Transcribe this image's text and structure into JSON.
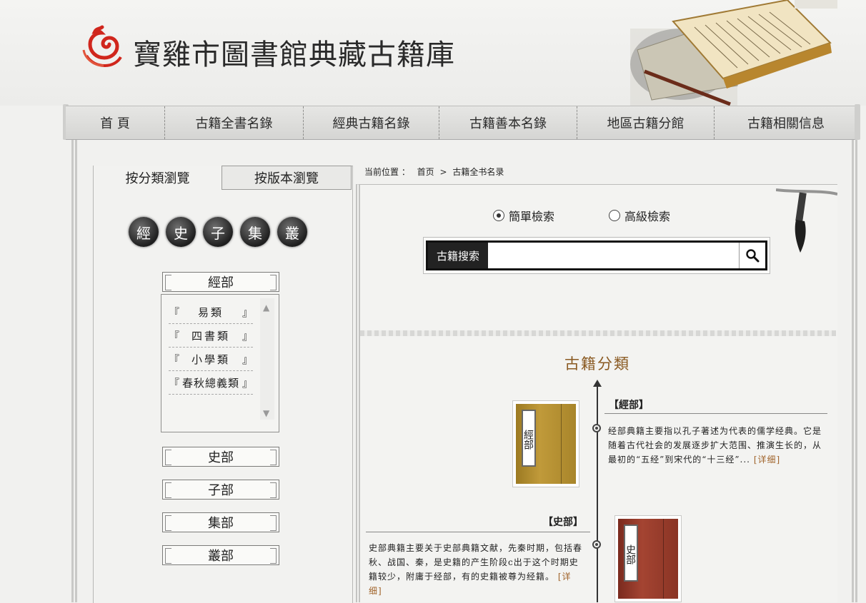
{
  "header": {
    "site_title": "寶雞市圖書館典藏古籍庫"
  },
  "nav": {
    "items": [
      "首 頁",
      "古籍全書名錄",
      "經典古籍名錄",
      "古籍善本名錄",
      "地區古籍分館",
      "古籍相關信息"
    ]
  },
  "left": {
    "tabs": [
      "按分類瀏覽",
      "按版本瀏覽"
    ],
    "quick_circles": [
      "經",
      "史",
      "子",
      "集",
      "叢"
    ],
    "categories": {
      "jing": "經部",
      "shi": "史部",
      "zi": "子部",
      "ji": "集部",
      "cong": "叢部"
    },
    "jing_sub": [
      {
        "open": "『",
        "name": "易類",
        "close": "』"
      },
      {
        "open": "『",
        "name": "四書類",
        "close": "』"
      },
      {
        "open": "『",
        "name": "小學類",
        "close": "』"
      },
      {
        "open": "『",
        "name": "春秋總義類",
        "close": "』"
      }
    ]
  },
  "breadcrumb": {
    "prefix": "当前位置 ：",
    "home": "首页",
    "sep": ">",
    "current": "古籍全书名录"
  },
  "search": {
    "radio_simple": "簡單檢索",
    "radio_advanced": "高級檢索",
    "label": "古籍搜索",
    "value": "",
    "placeholder": ""
  },
  "section_title": "古籍分類",
  "entries": {
    "jing": {
      "head": "【經部】",
      "cover_label": "經部",
      "text": "经部典籍主要指以孔子著述为代表的儒学经典。它是随着古代社会的发展逐步扩大范围、推演生长的，从最初的“五经”到宋代的“十三经”...",
      "more": "[详细]"
    },
    "shi": {
      "head": "【史部】",
      "cover_label": "史部",
      "text": "史部典籍主要关于史部典籍文献，先秦时期，包括春秋、战国、秦，是史籍的产生阶段c出于这个时期史籍较少，附庸于经部，有的史籍被尊为经籍。",
      "more": "[详细]"
    }
  },
  "colors": {
    "accent_brown": "#8a5a22",
    "jing_cover": "#b08a2a",
    "shi_cover": "#8e3424"
  }
}
